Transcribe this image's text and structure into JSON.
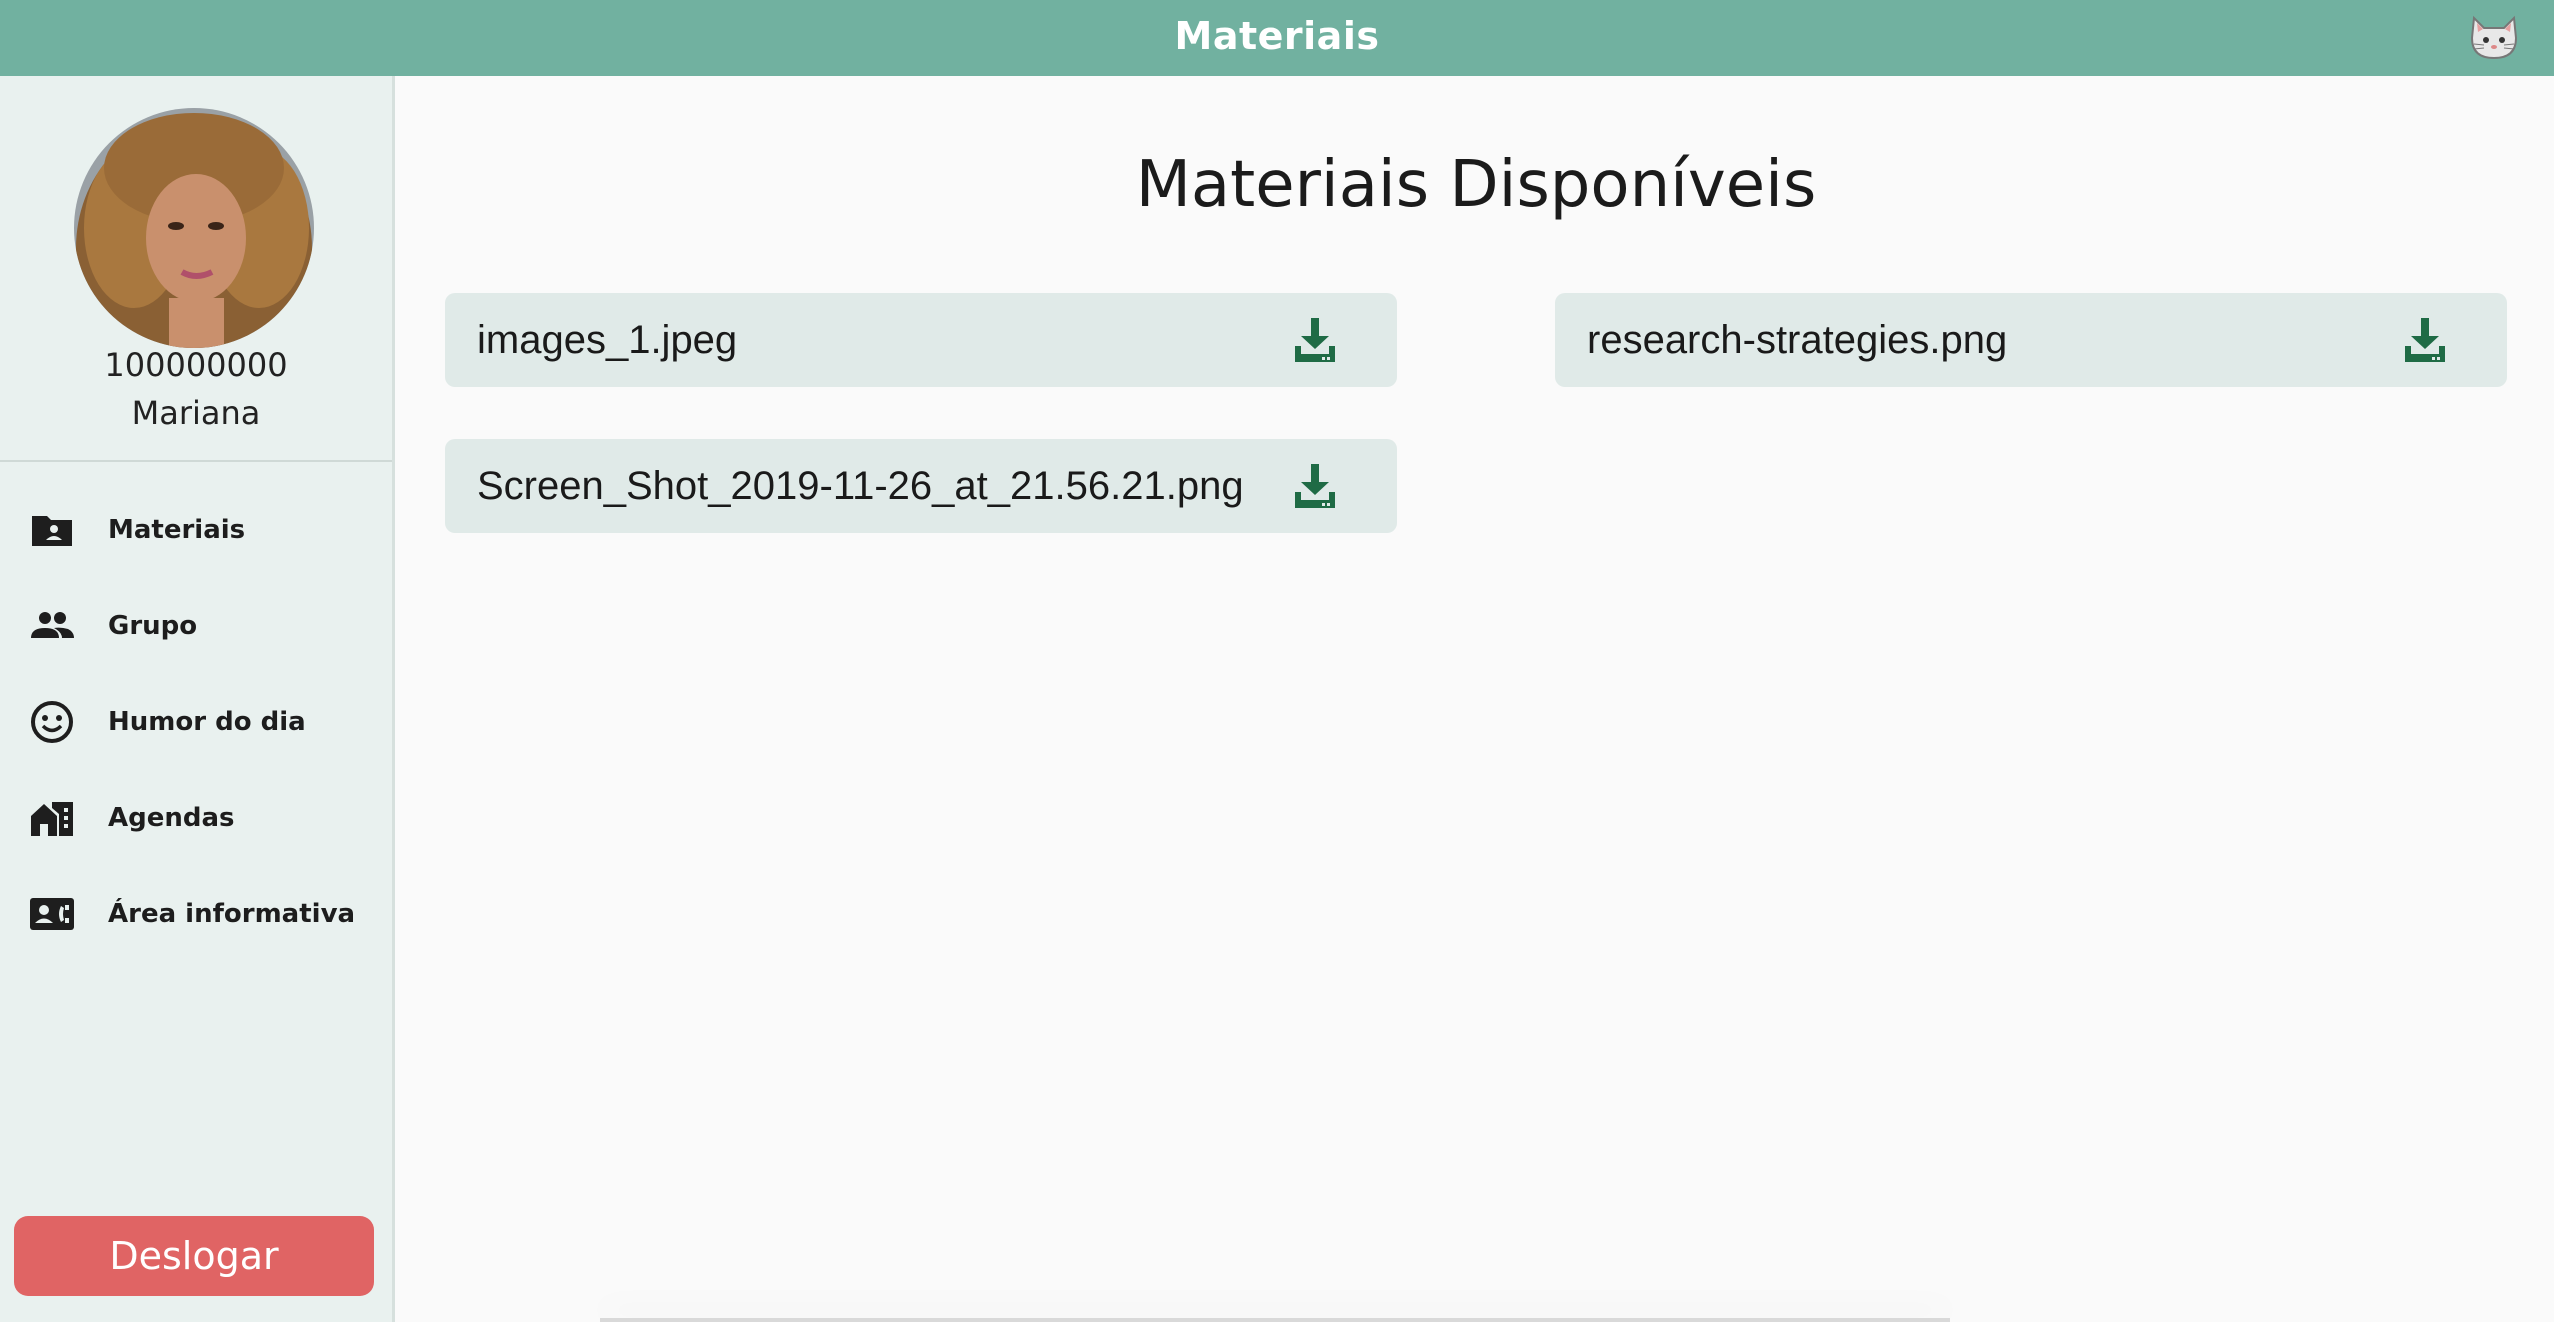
{
  "header": {
    "title": "Materiais",
    "mascot_icon": "cat-face-icon"
  },
  "sidebar": {
    "user_id": "100000000",
    "user_name": "Mariana",
    "items": [
      {
        "label": "Materiais",
        "icon": "folder-person-icon"
      },
      {
        "label": "Grupo",
        "icon": "people-icon"
      },
      {
        "label": "Humor do dia",
        "icon": "smiley-icon"
      },
      {
        "label": "Agendas",
        "icon": "buildings-icon"
      },
      {
        "label": "Área informativa",
        "icon": "contact-card-icon"
      }
    ],
    "logout_label": "Deslogar"
  },
  "main": {
    "title": "Materiais Disponíveis",
    "files": [
      {
        "name": "images_1.jpeg",
        "icon": "download-icon"
      },
      {
        "name": "research-strategies.png",
        "icon": "download-icon"
      },
      {
        "name": "Screen_Shot_2019-11-26_at_21.56.21.png",
        "icon": "download-icon"
      }
    ]
  },
  "colors": {
    "header": "#71b1a0",
    "sidebar": "#e9f1ef",
    "card": "#e0eae8",
    "download": "#1f6b45",
    "logout": "#e06464"
  }
}
